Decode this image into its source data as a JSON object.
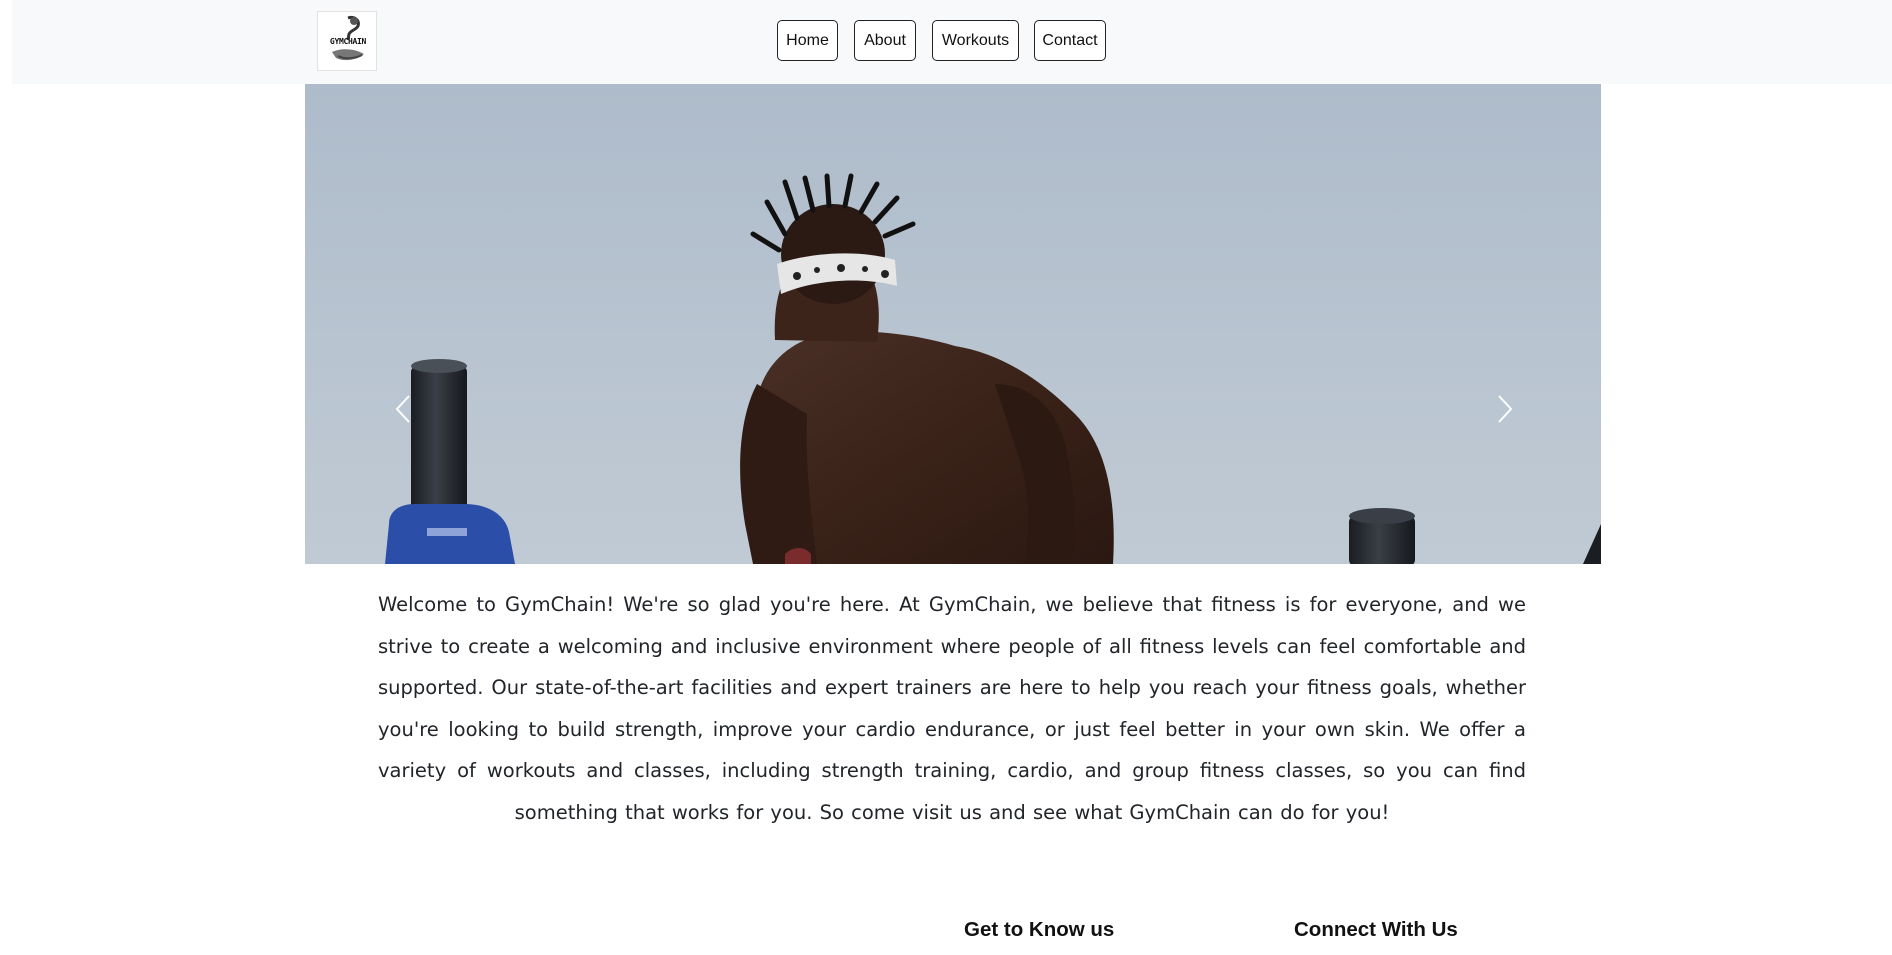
{
  "brand": {
    "logo_text": "GYMCHAIN"
  },
  "nav": {
    "items": [
      {
        "label": "Home"
      },
      {
        "label": "About"
      },
      {
        "label": "Workouts"
      },
      {
        "label": "Contact"
      }
    ]
  },
  "hero": {
    "image": "athlete-doing-dips-on-parallel-bars",
    "prev_icon": "chevron-left-icon",
    "next_icon": "chevron-right-icon"
  },
  "intro": {
    "text": "Welcome to GymChain! We're so glad you're here. At GymChain, we believe that fitness is for everyone, and we strive to create a welcoming and inclusive environment where people of all fitness levels can feel comfortable and supported. Our state-of-the-art facilities and expert trainers are here to help you reach your fitness goals, whether you're looking to build strength, improve your cardio endurance, or just feel better in your own skin. We offer a variety of workouts and classes, including strength training, cardio, and group fitness classes, so you can find something that works for you. So come visit us and see what GymChain can do for you!"
  },
  "footer": {
    "about_heading": "Get to Know us",
    "connect_heading": "Connect With Us"
  },
  "colors": {
    "navbar_bg": "#f8f9fa",
    "sky": "#b4c0cd",
    "text": "#212529"
  }
}
